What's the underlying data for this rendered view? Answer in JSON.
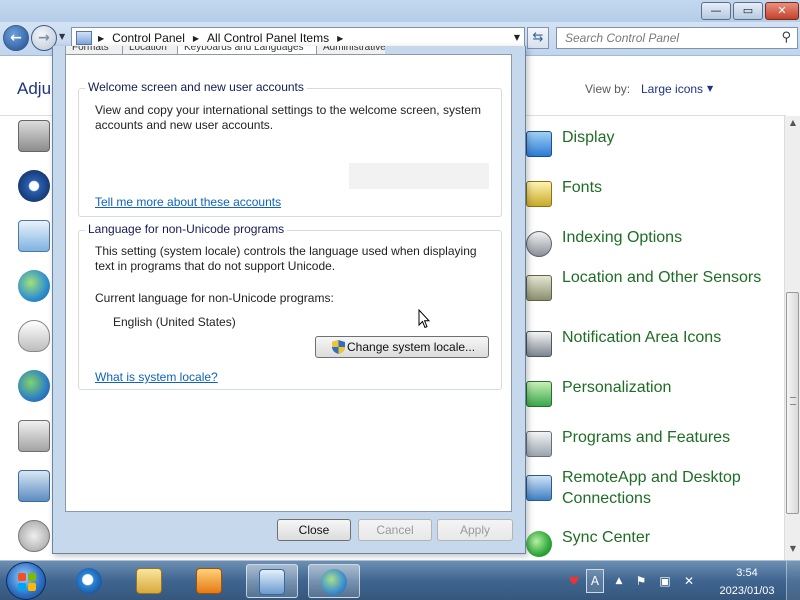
{
  "window": {
    "minimize_glyph": "—",
    "maximize_glyph": "▭",
    "close_glyph": "✕"
  },
  "navigation": {
    "back_glyph": "←",
    "forward_glyph": "→",
    "breadcrumbs": [
      "Control Panel",
      "All Control Panel Items"
    ],
    "search_placeholder": "Search Control Panel"
  },
  "content": {
    "heading_partial": "Adju",
    "view_by_label": "View by:",
    "view_by_value": "Large icons",
    "left_icons": [
      "admin-tools-icon",
      "ease-of-access-icon",
      "default-programs-icon",
      "internet-options-icon",
      "mouse-icon",
      "network-icon",
      "phone-modem-icon",
      "region-icon",
      "sound-icon"
    ],
    "right_items": [
      {
        "label": "Display",
        "icon": "display-icon",
        "color": "#2c7bd6"
      },
      {
        "label": "Fonts",
        "icon": "fonts-icon",
        "color": "#c8a92a"
      },
      {
        "label": "Indexing Options",
        "icon": "indexing-options-icon",
        "color": "#8a8f99"
      },
      {
        "label": "Location and Other Sensors",
        "icon": "location-sensors-icon",
        "color": "#8b8f6f"
      },
      {
        "label": "Notification Area Icons",
        "icon": "notification-area-icon",
        "color": "#7c8591"
      },
      {
        "label": "Personalization",
        "icon": "personalization-icon",
        "color": "#3aa64a"
      },
      {
        "label": "Programs and Features",
        "icon": "programs-features-icon",
        "color": "#9aa4ad"
      },
      {
        "label": "RemoteApp and Desktop Connections",
        "icon": "remoteapp-icon",
        "color": "#3f7fc1"
      },
      {
        "label": "Sync Center",
        "icon": "sync-center-icon",
        "color": "#2fa83a"
      }
    ]
  },
  "dialog": {
    "tabs": [
      "Formats",
      "Location",
      "Keyboards and Languages",
      "Administrative"
    ],
    "welcome_group": {
      "title": "Welcome screen and new user accounts",
      "description": "View and copy your international settings to the welcome screen, system accounts and new user accounts.",
      "link": "Tell me more about these accounts"
    },
    "unicode_group": {
      "title": "Language for non-Unicode programs",
      "description": "This setting (system locale) controls the language used when displaying text in programs that do not support Unicode.",
      "current_label": "Current language for non-Unicode programs:",
      "current_value": "English (United States)",
      "change_button": "Change system locale...",
      "link": "What is system locale?"
    },
    "buttons": {
      "close": "Close",
      "cancel": "Cancel",
      "apply": "Apply"
    }
  },
  "taskbar": {
    "time": "3:54",
    "date": "2023/01/03",
    "pinned": [
      "internet-explorer-icon",
      "windows-explorer-icon",
      "media-player-icon",
      "control-panel-icon",
      "region-language-icon"
    ],
    "tray": [
      "action-center-icon",
      "language-bar-icon",
      "show-hidden-icons",
      "flag-icon",
      "network-icon",
      "volume-muted-icon"
    ]
  }
}
